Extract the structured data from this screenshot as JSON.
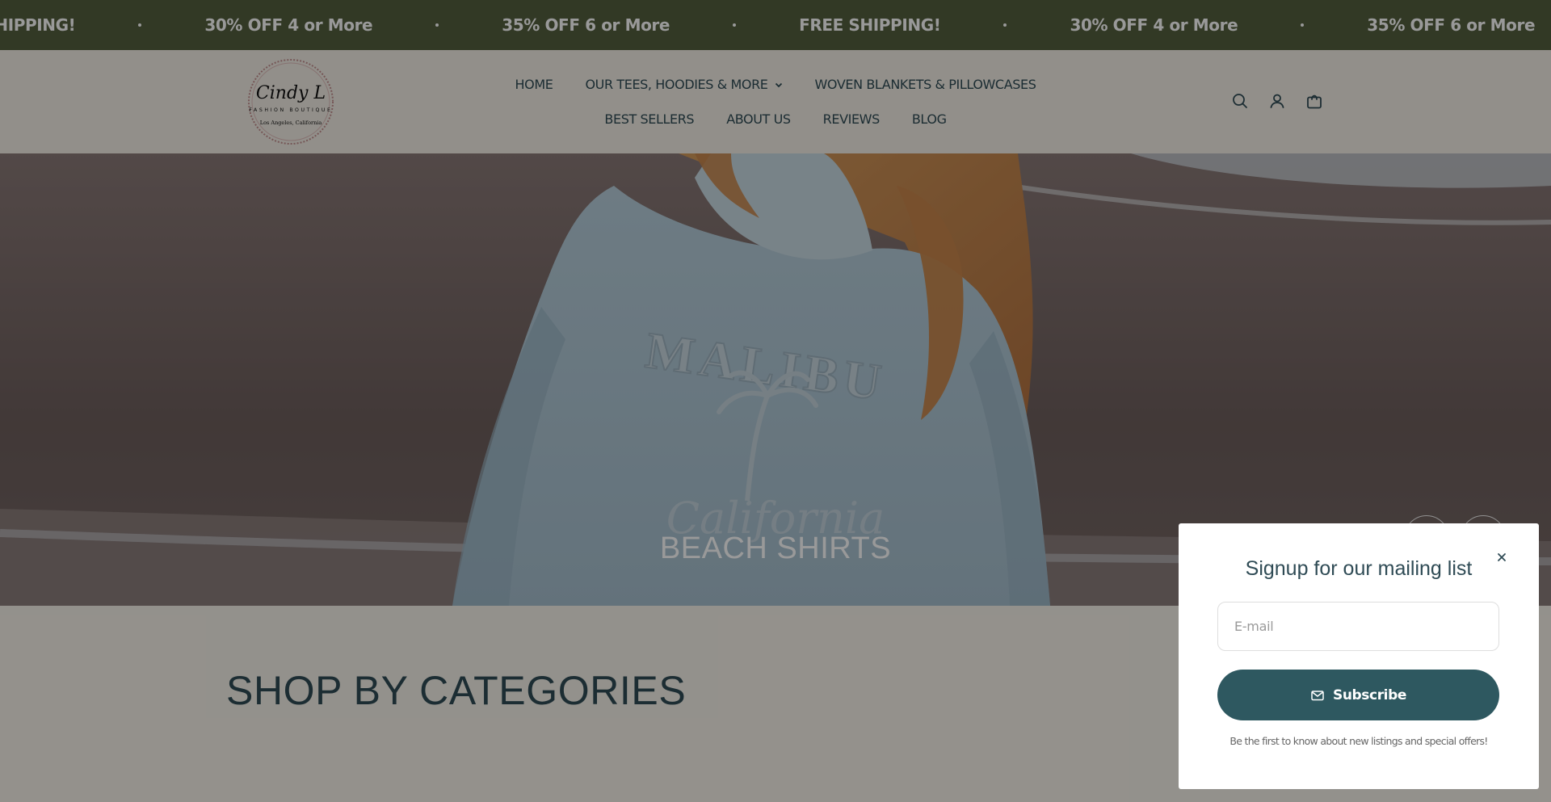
{
  "announcement": {
    "items": [
      "FREE SHIPPING!",
      "30% OFF 4 or More",
      "35% OFF 6 or More",
      "FREE SHIPPING!",
      "30% OFF 4 or More",
      "35% OFF 6 or More"
    ],
    "background_color": "#545f3f"
  },
  "logo": {
    "script_text": "Cindy L",
    "tagline": "FASHION BOUTIQUE",
    "location": "Los Angeles, California"
  },
  "nav": {
    "row1": [
      {
        "label": "HOME"
      },
      {
        "label": "OUR TEES, HOODIES & MORE",
        "dropdown": true
      },
      {
        "label": "WOVEN BLANKETS & PILLOWCASES"
      }
    ],
    "row2": [
      {
        "label": "BEST SELLERS"
      },
      {
        "label": "ABOUT US"
      },
      {
        "label": "REVIEWS"
      },
      {
        "label": "BLOG"
      }
    ]
  },
  "header_icons": [
    "search-icon",
    "account-icon",
    "cart-icon"
  ],
  "hero": {
    "caption": "BEACH SHIRTS",
    "shirt_print_top": "MALIBU",
    "shirt_print_bottom": "California"
  },
  "categories": {
    "title": "SHOP BY CATEGORIES"
  },
  "popup": {
    "title": "Signup for our mailing list",
    "email_placeholder": "E-mail",
    "email_value": "",
    "subscribe_label": "Subscribe",
    "note": "Be the first to know about new listings and special offers!",
    "accent_color": "#2e5860"
  },
  "colors": {
    "text_dark": "#2f4b55",
    "header_bg": "#f3efe6"
  }
}
